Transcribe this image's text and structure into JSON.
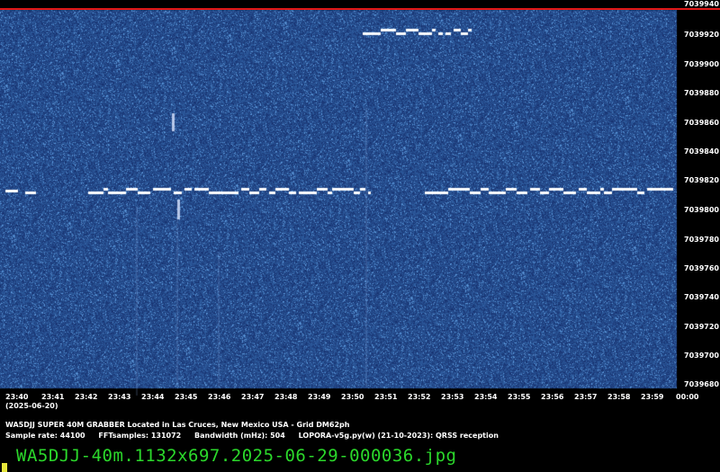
{
  "y_axis": [
    "7039940",
    "7039920",
    "7039900",
    "7039880",
    "7039860",
    "7039840",
    "7039820",
    "7039800",
    "7039780",
    "7039760",
    "7039740",
    "7039720",
    "7039700",
    "7039680"
  ],
  "x_axis": [
    "23:40",
    "23:41",
    "23:42",
    "23:43",
    "23:44",
    "23:45",
    "23:46",
    "23:47",
    "23:48",
    "23:49",
    "23:50",
    "23:51",
    "23:52",
    "23:53",
    "23:54",
    "23:55",
    "23:56",
    "23:57",
    "23:58",
    "23:59",
    "00:00"
  ],
  "date": "(2025-06-20)",
  "station": "WA5DJJ SUPER 40M GRABBER Located in Las Cruces, New Mexico USA - Grid DM62ph",
  "params": {
    "sample_rate": "Sample rate: 44100",
    "fft": "FFTsamples: 131072",
    "bandwidth": "Bandwidth (mHz): 504",
    "software": "LOPORA-v5g.py(w) (21-10-2023): QRSS reception"
  },
  "filename": "WA5DJJ-40m.1132x697.2025-06-29-000036.jpg",
  "colors": {
    "background": "#1e3a7c",
    "signal": "#ffffff",
    "top_line": "#e01818",
    "filename_text": "#2bd82b"
  }
}
